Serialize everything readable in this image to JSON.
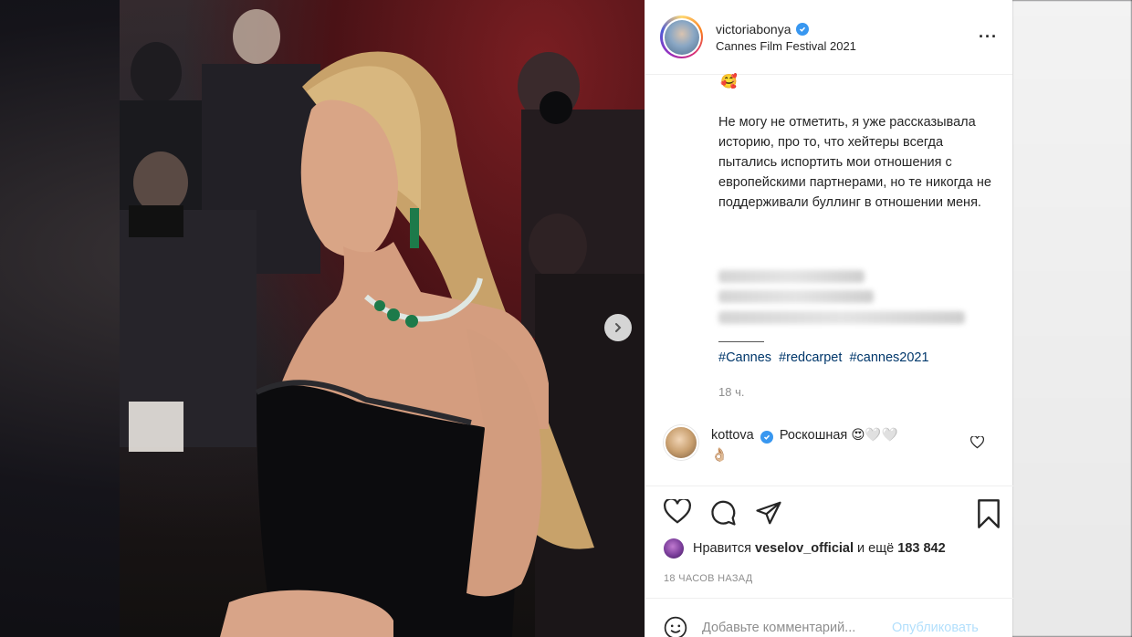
{
  "post": {
    "username": "victoriabonya",
    "location": "Cannes Film Festival 2021",
    "caption_emoji": "🥰",
    "caption": "Не могу не отметить, я уже рассказывала историю, про то, что хейтеры всегда пытались испортить мои отношения с европейскими партнерами, но те никогда не поддерживали буллинг в отношении меня.",
    "hashtags": [
      "#Cannes",
      "#redcarpet",
      "#cannes2021"
    ],
    "caption_time": "18 ч.",
    "comment": {
      "username": "kottova",
      "text": "Роскошная 😍🤍🤍",
      "emoji_line": "👌🏼"
    },
    "likes": {
      "prefix": "Нравится",
      "user": "veselov_official",
      "middle": "и ещё",
      "count": "183 842"
    },
    "time_ago": "18 ЧАСОВ НАЗАД",
    "comment_placeholder": "Добавьте комментарий...",
    "publish_label": "Опубликовать"
  },
  "icons": {
    "more": "more-options-icon",
    "like": "heart-icon",
    "comment": "comment-icon",
    "share": "share-icon",
    "save": "bookmark-icon",
    "emoji": "emoji-icon",
    "next": "chevron-right-icon"
  },
  "colors": {
    "verified": "#3897f0",
    "link": "#00376b",
    "publish": "#b2dffc",
    "muted": "#8e8e8e"
  }
}
